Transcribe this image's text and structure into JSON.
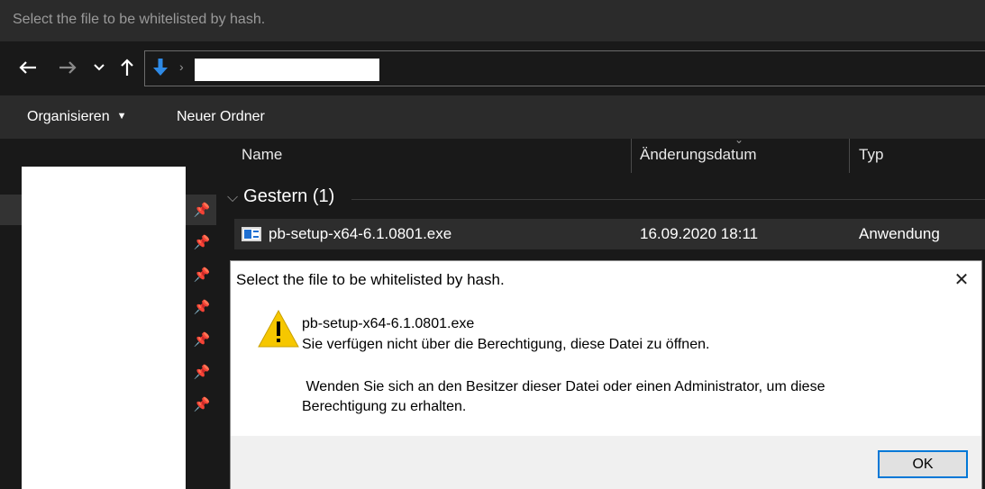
{
  "window": {
    "title": "Select the file to be whitelisted by hash."
  },
  "navigation": {
    "back_icon": "arrow-left-icon",
    "forward_icon": "arrow-right-icon",
    "recent_icon": "chevron-down-icon",
    "up_icon": "arrow-up-icon",
    "location_icon": "downloads-icon",
    "path_separator": "›"
  },
  "toolbar": {
    "organize_label": "Organisieren",
    "new_folder_label": "Neuer Ordner"
  },
  "file_list": {
    "columns": [
      "Name",
      "Änderungsdatum",
      "Typ"
    ],
    "group_label": "Gestern (1)",
    "rows": [
      {
        "name": "pb-setup-x64-6.1.0801.exe",
        "date": "16.09.2020 18:11",
        "type": "Anwendung"
      }
    ]
  },
  "dialog": {
    "title": "Select the file to be whitelisted by hash.",
    "icon": "warning-icon",
    "file_name": "pb-setup-x64-6.1.0801.exe",
    "message_line1": "Sie verfügen nicht über die Berechtigung, diese Datei zu öffnen.",
    "message_line2": " Wenden Sie sich an den Besitzer dieser Datei oder einen Administrator, um diese",
    "message_line3": "Berechtigung zu erhalten.",
    "ok_label": "OK",
    "close_glyph": "✕"
  },
  "colors": {
    "explorer_bg": "#191919",
    "toolbar_bg": "#2b2b2b",
    "warning_yellow": "#f6c700",
    "accent_blue": "#0078d7"
  }
}
